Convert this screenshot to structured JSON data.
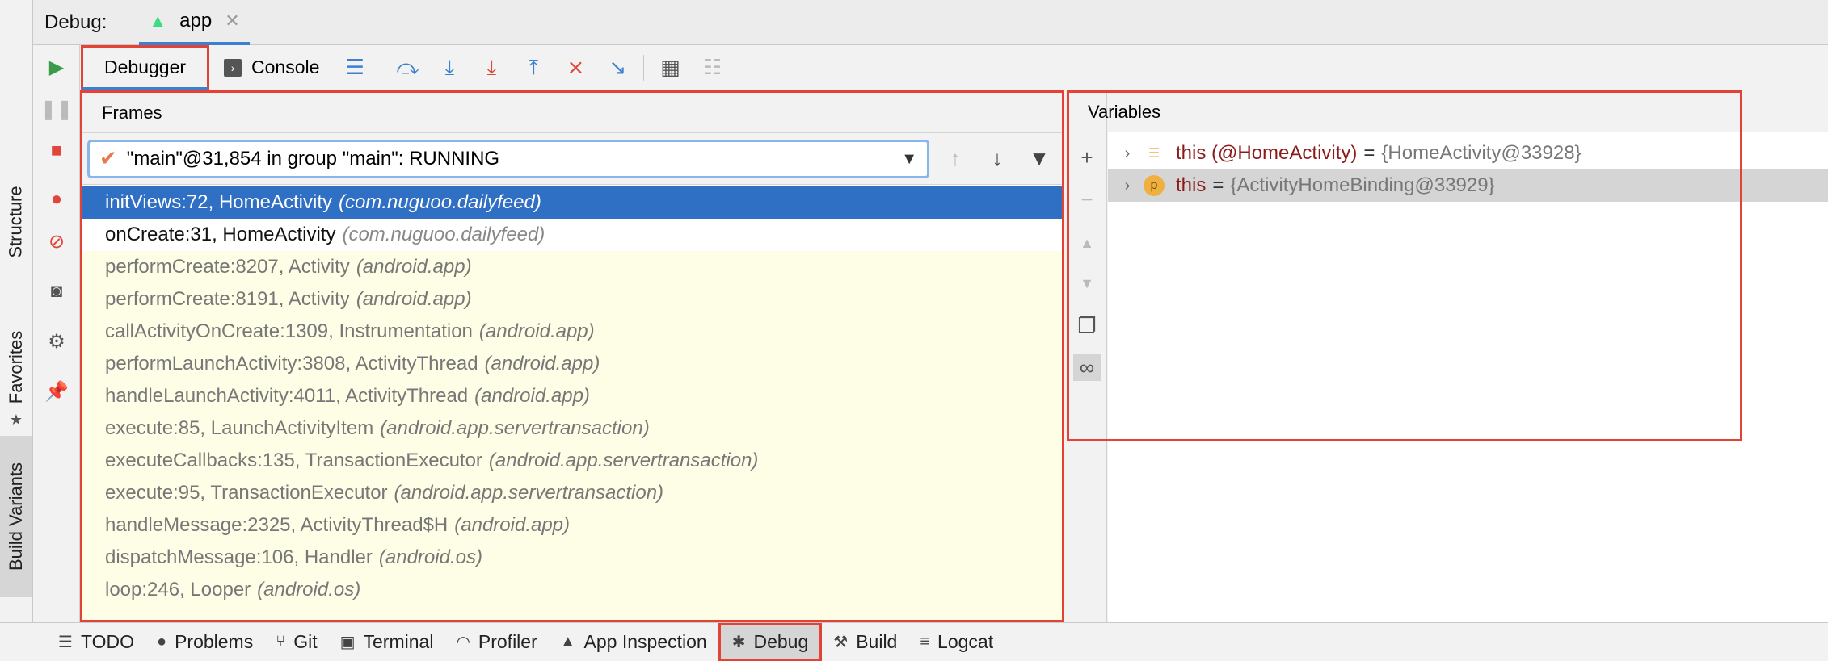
{
  "title_bar": {
    "label": "Debug:",
    "tab_label": "app"
  },
  "left_strip": {
    "structure": "Structure",
    "favorites": "Favorites",
    "build_variants": "Build Variants"
  },
  "toolbar": {
    "debugger_tab": "Debugger",
    "console_tab": "Console"
  },
  "frames": {
    "header": "Frames",
    "thread": "\"main\"@31,854 in group \"main\": RUNNING",
    "items": [
      {
        "method": "initViews:72, HomeActivity",
        "pkg": "(com.nuguoo.dailyfeed)"
      },
      {
        "method": "onCreate:31, HomeActivity",
        "pkg": "(com.nuguoo.dailyfeed)"
      },
      {
        "method": "performCreate:8207, Activity",
        "pkg": "(android.app)"
      },
      {
        "method": "performCreate:8191, Activity",
        "pkg": "(android.app)"
      },
      {
        "method": "callActivityOnCreate:1309, Instrumentation",
        "pkg": "(android.app)"
      },
      {
        "method": "performLaunchActivity:3808, ActivityThread",
        "pkg": "(android.app)"
      },
      {
        "method": "handleLaunchActivity:4011, ActivityThread",
        "pkg": "(android.app)"
      },
      {
        "method": "execute:85, LaunchActivityItem",
        "pkg": "(android.app.servertransaction)"
      },
      {
        "method": "executeCallbacks:135, TransactionExecutor",
        "pkg": "(android.app.servertransaction)"
      },
      {
        "method": "execute:95, TransactionExecutor",
        "pkg": "(android.app.servertransaction)"
      },
      {
        "method": "handleMessage:2325, ActivityThread$H",
        "pkg": "(android.app)"
      },
      {
        "method": "dispatchMessage:106, Handler",
        "pkg": "(android.os)"
      },
      {
        "method": "loop:246, Looper",
        "pkg": "(android.os)"
      }
    ]
  },
  "variables": {
    "header": "Variables",
    "items": [
      {
        "icon": "field-icon",
        "name": "this (@HomeActivity)",
        "eq": "=",
        "value": "{HomeActivity@33928}"
      },
      {
        "icon": "p",
        "name": "this",
        "eq": "=",
        "value": "{ActivityHomeBinding@33929}"
      }
    ]
  },
  "bottom_bar": {
    "todo": "TODO",
    "problems": "Problems",
    "git": "Git",
    "terminal": "Terminal",
    "profiler": "Profiler",
    "app_inspection": "App Inspection",
    "debug": "Debug",
    "build": "Build",
    "logcat": "Logcat"
  },
  "colors": {
    "highlight_box": "#e34234",
    "selection": "#2f6fc4",
    "frame_bg": "#fefde6"
  }
}
